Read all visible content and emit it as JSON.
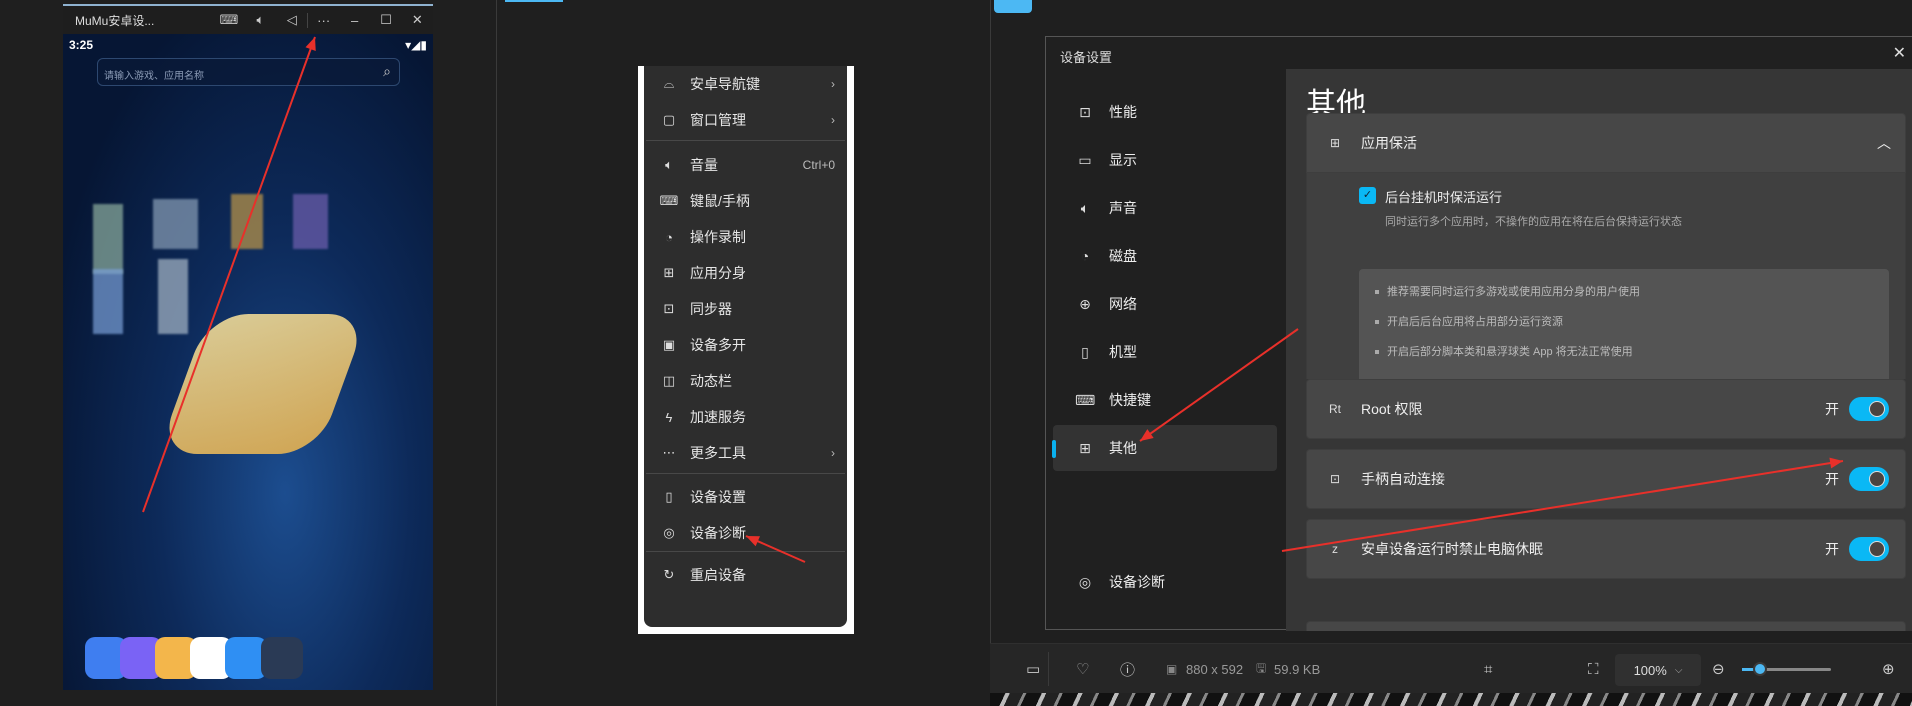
{
  "phone_window": {
    "title": "MuMu安卓设...",
    "controls": [
      "keyboard-icon",
      "volume-icon",
      "back-icon",
      "more-icon",
      "minimize-icon",
      "maximize-icon",
      "close-icon"
    ],
    "time": "3:25",
    "search_placeholder": "请输入游戏、应用名称",
    "dock_apps": [
      {
        "icon": "settings-app-icon",
        "color": "#3f7ef0"
      },
      {
        "icon": "gallery-app-icon",
        "color": "#7a63f5"
      },
      {
        "icon": "files-app-icon",
        "color": "#f3b64b"
      },
      {
        "icon": "browser-app-icon",
        "color": "#ffffff"
      },
      {
        "icon": "app-store-icon",
        "color": "#2f8ff3"
      },
      {
        "icon": "folder-icon",
        "color": "#2a3a55"
      }
    ]
  },
  "context_menu": {
    "items": [
      {
        "label": "安卓导航键",
        "icon": "android-icon",
        "submenu": true
      },
      {
        "label": "窗口管理",
        "icon": "window-settings-icon",
        "submenu": true
      },
      {
        "label": "音量",
        "icon": "volume-icon",
        "shortcut": "Ctrl+0"
      },
      {
        "label": "键鼠/手柄",
        "icon": "keyboard-icon"
      },
      {
        "label": "操作录制",
        "icon": "record-icon"
      },
      {
        "label": "应用分身",
        "icon": "app-clone-icon"
      },
      {
        "label": "同步器",
        "icon": "sync-icon"
      },
      {
        "label": "设备多开",
        "icon": "multi-instance-icon"
      },
      {
        "label": "动态栏",
        "icon": "dynamic-bar-icon"
      },
      {
        "label": "加速服务",
        "icon": "boost-icon"
      },
      {
        "label": "更多工具",
        "icon": "more-tools-icon",
        "submenu": true
      },
      {
        "label": "设备设置",
        "icon": "device-settings-icon"
      },
      {
        "label": "设备诊断",
        "icon": "diagnose-icon"
      },
      {
        "label": "重启设备",
        "icon": "restart-icon"
      }
    ]
  },
  "settings_dialog": {
    "title": "设备设置",
    "sidebar": [
      {
        "label": "性能",
        "icon": "performance-icon"
      },
      {
        "label": "显示",
        "icon": "display-icon"
      },
      {
        "label": "声音",
        "icon": "sound-icon"
      },
      {
        "label": "磁盘",
        "icon": "disk-icon"
      },
      {
        "label": "网络",
        "icon": "network-icon"
      },
      {
        "label": "机型",
        "icon": "phone-model-icon"
      },
      {
        "label": "快捷键",
        "icon": "shortcut-icon"
      },
      {
        "label": "其他",
        "icon": "other-icon",
        "selected": true
      }
    ],
    "sidebar_bottom": {
      "label": "设备诊断",
      "icon": "diagnose-icon"
    },
    "page_title": "其他",
    "keepalive": {
      "header": "应用保活",
      "checkbox_label": "后台挂机时保活运行",
      "checked": true,
      "description": "同时运行多个应用时，不操作的应用在将在后台保持运行状态",
      "bullets": [
        "推荐需要同时运行多游戏或使用应用分身的用户使用",
        "开启后后台应用将占用部分运行资源",
        "开启后部分脚本类和悬浮球类 App 将无法正常使用"
      ]
    },
    "toggles": [
      {
        "label": "Root 权限",
        "icon": "root-icon",
        "state_label": "开",
        "on": true
      },
      {
        "label": "手柄自动连接",
        "icon": "gamepad-icon",
        "state_label": "开",
        "on": true
      },
      {
        "label": "安卓设备运行时禁止电脑休眠",
        "icon": "sleep-icon",
        "state_label": "开",
        "on": true
      }
    ],
    "accent": "#0ab8f5"
  },
  "viewer_toolbar": {
    "dimensions": "880 x 592",
    "file_size": "59.9 KB",
    "zoom": "100%",
    "zoom_fraction": 0.2
  },
  "annotation_color": "#e8302a"
}
